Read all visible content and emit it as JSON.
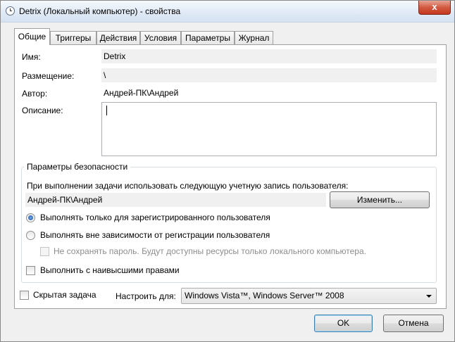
{
  "window": {
    "title": "Detrix (Локальный компьютер) - свойства",
    "close_label": "x",
    "icon": "clock-icon"
  },
  "tabs": [
    {
      "label": "Общие"
    },
    {
      "label": "Триггеры"
    },
    {
      "label": "Действия"
    },
    {
      "label": "Условия"
    },
    {
      "label": "Параметры"
    },
    {
      "label": "Журнал"
    }
  ],
  "general": {
    "name_label": "Имя:",
    "name_value": "Detrix",
    "location_label": "Размещение:",
    "location_value": "\\",
    "author_label": "Автор:",
    "author_value": "Андрей-ПК\\Андрей",
    "description_label": "Описание:",
    "description_value": ""
  },
  "security": {
    "group_title": "Параметры безопасности",
    "account_prompt": "При выполнении задачи использовать следующую учетную запись пользователя:",
    "account_value": "Андрей-ПК\\Андрей",
    "change_button": "Изменить...",
    "radio_logged_on": "Выполнять только для зарегистрированного пользователя",
    "radio_any": "Выполнять вне зависимости от регистрации пользователя",
    "no_store_password": "Не сохранять пароль. Будут доступны ресурсы только локального компьютера.",
    "highest_privileges": "Выполнить с наивысшими правами"
  },
  "footer": {
    "hidden_task": "Скрытая задача",
    "configure_for_label": "Настроить для:",
    "configure_for_value": "Windows Vista™, Windows Server™ 2008",
    "ok_button": "OK",
    "cancel_button": "Отмена"
  }
}
